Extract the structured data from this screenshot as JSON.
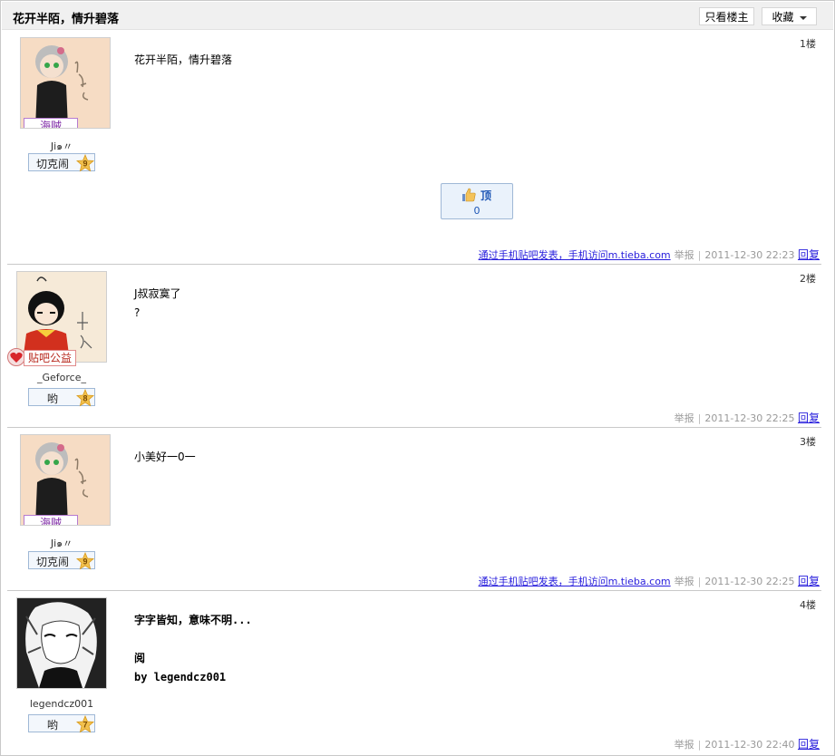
{
  "header": {
    "title": "花开半陌，情升碧落",
    "only_author": "只看楼主",
    "favorite": "收藏"
  },
  "colors": {
    "link": "#261cdc",
    "meta": "#999999",
    "badge_pirate": "#7f2aa6",
    "badge_charity": "#b8281d"
  },
  "posts": [
    {
      "floor": "1楼",
      "username": "Ji๑〃",
      "badge": "海贼",
      "level_label": "切克闹",
      "level": "9",
      "content": [
        "花开半陌，情升碧落"
      ],
      "like_label": "顶",
      "like_count": "0",
      "via_mobile": "通过手机贴吧发表，手机访问m.tieba.com",
      "report": "举报",
      "time": "2011-12-30 22:23",
      "reply": "回复"
    },
    {
      "floor": "2楼",
      "username": "_Geforce_",
      "badge": "贴吧公益",
      "level_label": "哟",
      "level": "8",
      "content": [
        "J叔寂寞了",
        "?"
      ],
      "report": "举报",
      "time": "2011-12-30 22:25",
      "reply": "回复"
    },
    {
      "floor": "3楼",
      "username": "Ji๑〃",
      "badge": "海贼",
      "level_label": "切克闹",
      "level": "9",
      "content": [
        "小美好一0一"
      ],
      "via_mobile": "通过手机贴吧发表，手机访问m.tieba.com",
      "report": "举报",
      "time": "2011-12-30 22:25",
      "reply": "回复"
    },
    {
      "floor": "4楼",
      "username": "legendcz001",
      "level_label": "哟",
      "level": "7",
      "content": [
        "字字皆知，意味不明...",
        "",
        "阅",
        "by legendcz001"
      ],
      "report": "举报",
      "time": "2011-12-30 22:40",
      "reply": "回复"
    }
  ]
}
